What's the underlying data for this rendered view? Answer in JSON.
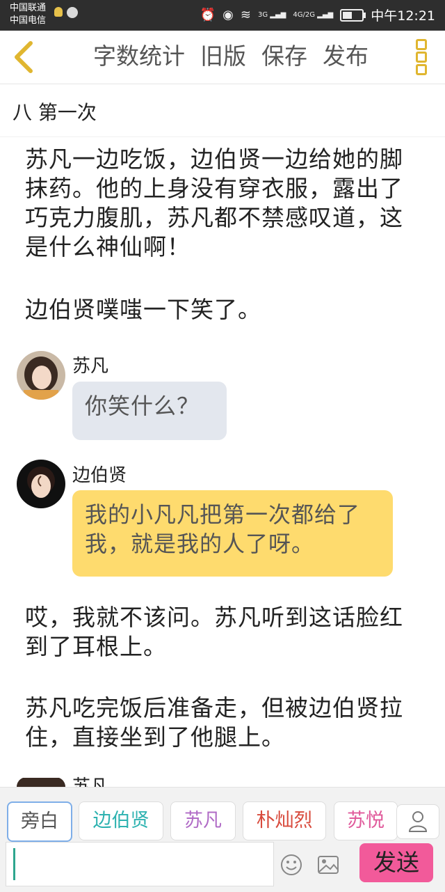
{
  "status": {
    "carrier1": "中国联通",
    "carrier2": "中国电信",
    "net1": "3G",
    "net2a": "4G",
    "net2b": "2G",
    "time": "中午12:21",
    "battery_level": 0.5
  },
  "header": {
    "menu": [
      "字数统计",
      "旧版",
      "保存",
      "发布"
    ]
  },
  "chapter_title": "八 第一次",
  "paragraphs": [
    "苏凡一边吃饭，边伯贤一边给她的脚抹药。他的上身没有穿衣服，露出了巧克力腹肌，苏凡都不禁感叹道，这是什么神仙啊！",
    "边伯贤噗嗤一下笑了。",
    "哎，我就不该问。苏凡听到这话脸红到了耳根上。",
    "苏凡吃完饭后准备走，但被边伯贤拉住，直接坐到了他腿上。"
  ],
  "messages": [
    {
      "speaker": "苏凡",
      "text": "你笑什么？"
    },
    {
      "speaker": "边伯贤",
      "text": "我的小凡凡把第一次都给了我，就是我的人了呀。"
    }
  ],
  "partial_speaker": "苏凡",
  "roles": [
    {
      "label": "旁白",
      "color": "#555555"
    },
    {
      "label": "边伯贤",
      "color": "#2db2b0"
    },
    {
      "label": "苏凡",
      "color": "#b06bc6"
    },
    {
      "label": "朴灿烈",
      "color": "#d84a3c"
    },
    {
      "label": "苏悦",
      "color": "#e05a9b"
    }
  ],
  "send_label": "发送",
  "colors": {
    "accent": "#e0b630",
    "send": "#f25a9a",
    "bubble_yellow": "#fedb6e",
    "bubble_grey": "#e3e7ee"
  }
}
